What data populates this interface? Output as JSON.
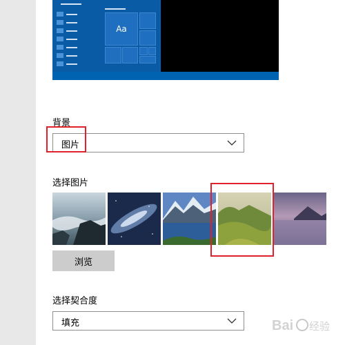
{
  "background_section": {
    "label": "背景",
    "dropdown_value": "图片"
  },
  "choose_picture": {
    "label": "选择图片",
    "browse_label": "浏览",
    "thumbnails": [
      "coastal-rocks",
      "galaxy",
      "mountain-lake",
      "green-hills",
      "misty-lake"
    ],
    "selected_index": 3
  },
  "fit_section": {
    "label": "选择契合度",
    "dropdown_value": "填充"
  },
  "preview": {
    "tile_text": "Aa"
  },
  "watermark": {
    "text": "Baidu 经验"
  },
  "colors": {
    "highlight": "#e0202a",
    "preview_blue": "#0063b1"
  }
}
